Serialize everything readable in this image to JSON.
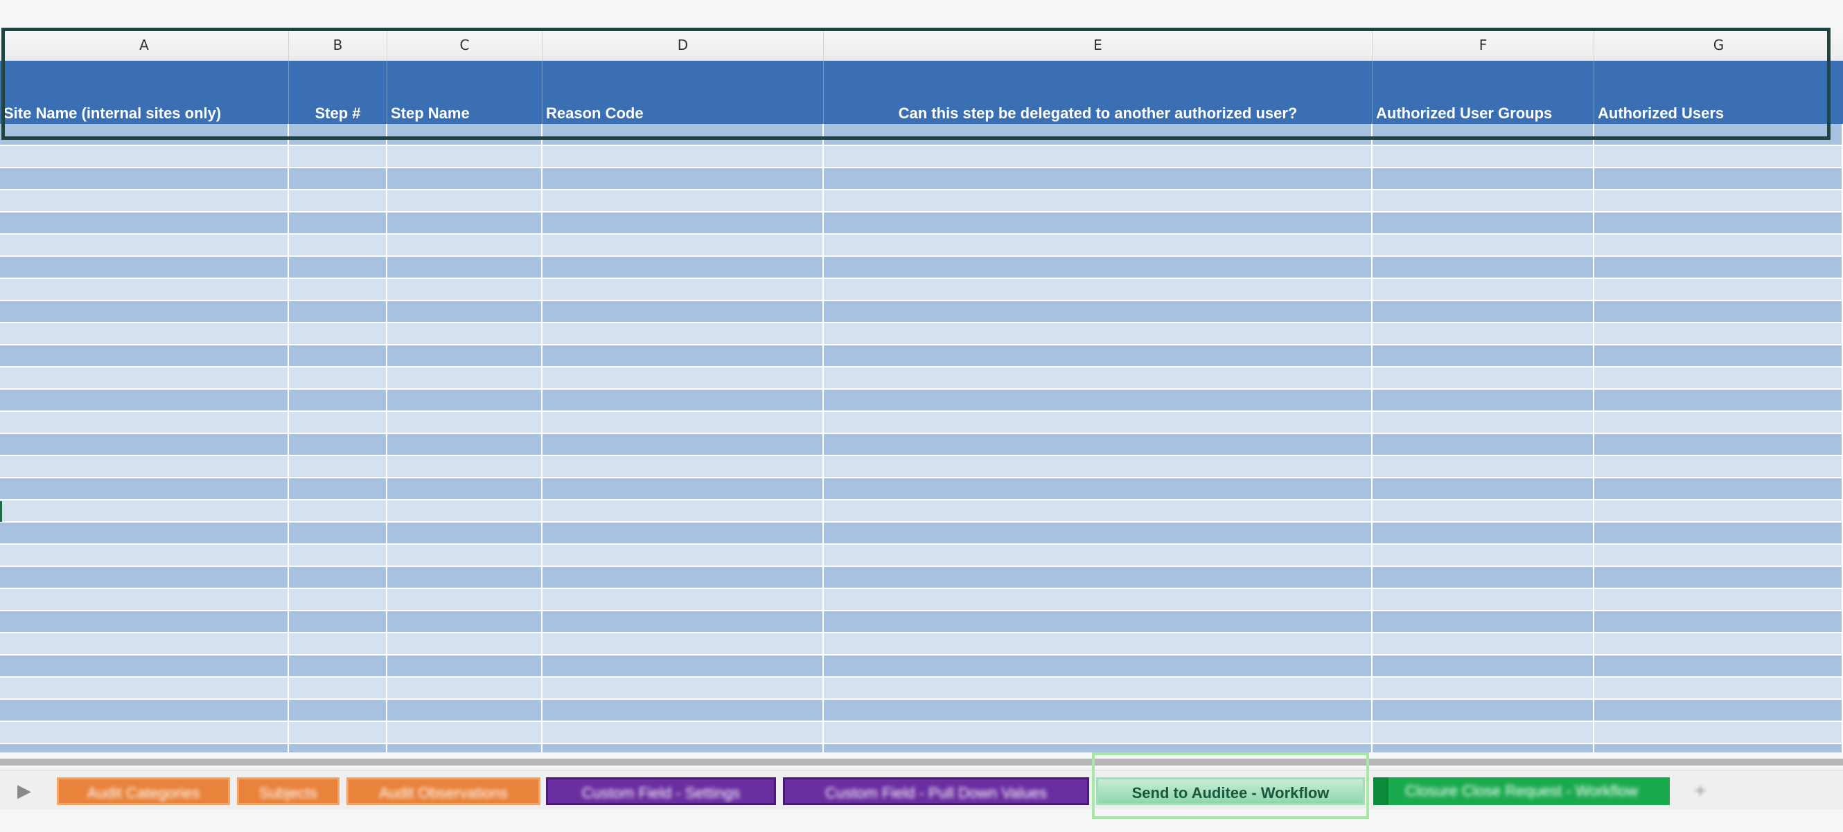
{
  "columns": {
    "letters": [
      "A",
      "B",
      "C",
      "D",
      "E",
      "F",
      "G"
    ]
  },
  "headers": [
    "Site Name (internal sites only)",
    "Step #",
    "Step Name",
    "Reason Code",
    "Can this step be delegated to another authorized user?",
    "Authorized User Groups",
    "Authorized Users"
  ],
  "sheet_tabs": {
    "nav_icon": "play-triangle-icon",
    "tabs": [
      {
        "label": "Audit Categories",
        "color": "#e9823a",
        "active": false
      },
      {
        "label": "Subjects",
        "color": "#e9823a",
        "active": false
      },
      {
        "label": "Audit Observations",
        "color": "#e9823a",
        "active": false
      },
      {
        "label": "Custom Field - Settings",
        "color": "#6a2ea0",
        "active": false
      },
      {
        "label": "Custom Field - Pull Down Values",
        "color": "#6a2ea0",
        "active": false
      },
      {
        "label": "Send to Auditee - Workflow",
        "color": "#8fd6ac",
        "active": true
      },
      {
        "label": "Closure Close Request - Workflow",
        "color": "#1aaa4e",
        "active": false
      }
    ],
    "add_icon": "plus-icon"
  },
  "colors": {
    "header_blue": "#3a6fb3",
    "row_light": "#d5e1ef",
    "row_dark": "#a9c1e1",
    "selection": "#1f4540"
  }
}
